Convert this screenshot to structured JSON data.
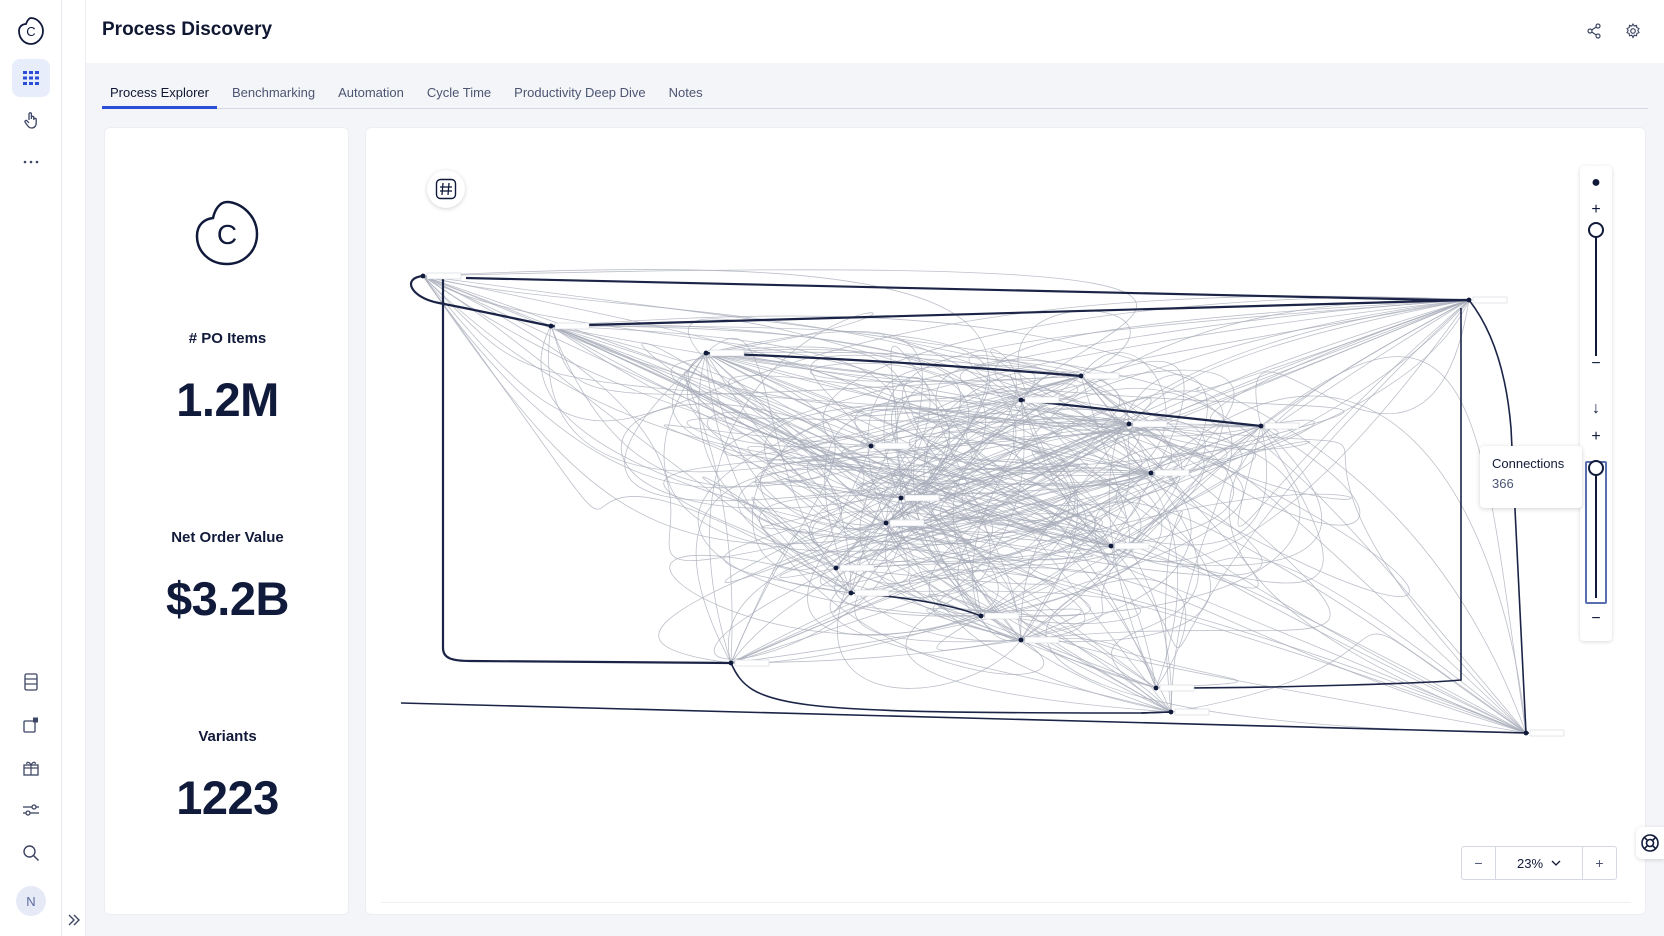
{
  "header": {
    "title": "Process Discovery",
    "icons": [
      "share-icon",
      "gear-icon"
    ]
  },
  "sidebar": {
    "top_items": [
      "logo-icon",
      "apps-grid-icon",
      "hand-pointer-icon",
      "more-icon"
    ],
    "bottom_items": [
      "document-icon",
      "external-link-icon",
      "gift-icon",
      "sliders-icon",
      "search-icon"
    ],
    "avatar_initial": "N",
    "expand_icon": "double-chevron-right-icon"
  },
  "tabs": [
    {
      "label": "Process Explorer",
      "active": true
    },
    {
      "label": "Benchmarking",
      "active": false
    },
    {
      "label": "Automation",
      "active": false
    },
    {
      "label": "Cycle Time",
      "active": false
    },
    {
      "label": "Productivity Deep Dive",
      "active": false
    },
    {
      "label": "Notes",
      "active": false
    }
  ],
  "kpis": {
    "po_items_label": "# PO Items",
    "po_items_value": "1.2M",
    "net_order_label": "Net Order Value",
    "net_order_value": "$3.2B",
    "variants_label": "Variants",
    "variants_value": "1223"
  },
  "graph": {
    "hash_icon": "hash-icon",
    "activity_slider": {
      "top_symbol": "●",
      "plus": "+",
      "minus": "−",
      "level": 1.0
    },
    "connections_slider": {
      "top_symbol": "↓",
      "plus": "+",
      "minus": "−",
      "level": 1.0
    },
    "tooltip_label": "Connections",
    "tooltip_value": "366",
    "zoom_minus": "−",
    "zoom_value": "23%",
    "zoom_plus": "+"
  },
  "colors": {
    "accent": "#2a4fd6",
    "text_dark": "#101a3b",
    "edge": "#a7abb8"
  }
}
